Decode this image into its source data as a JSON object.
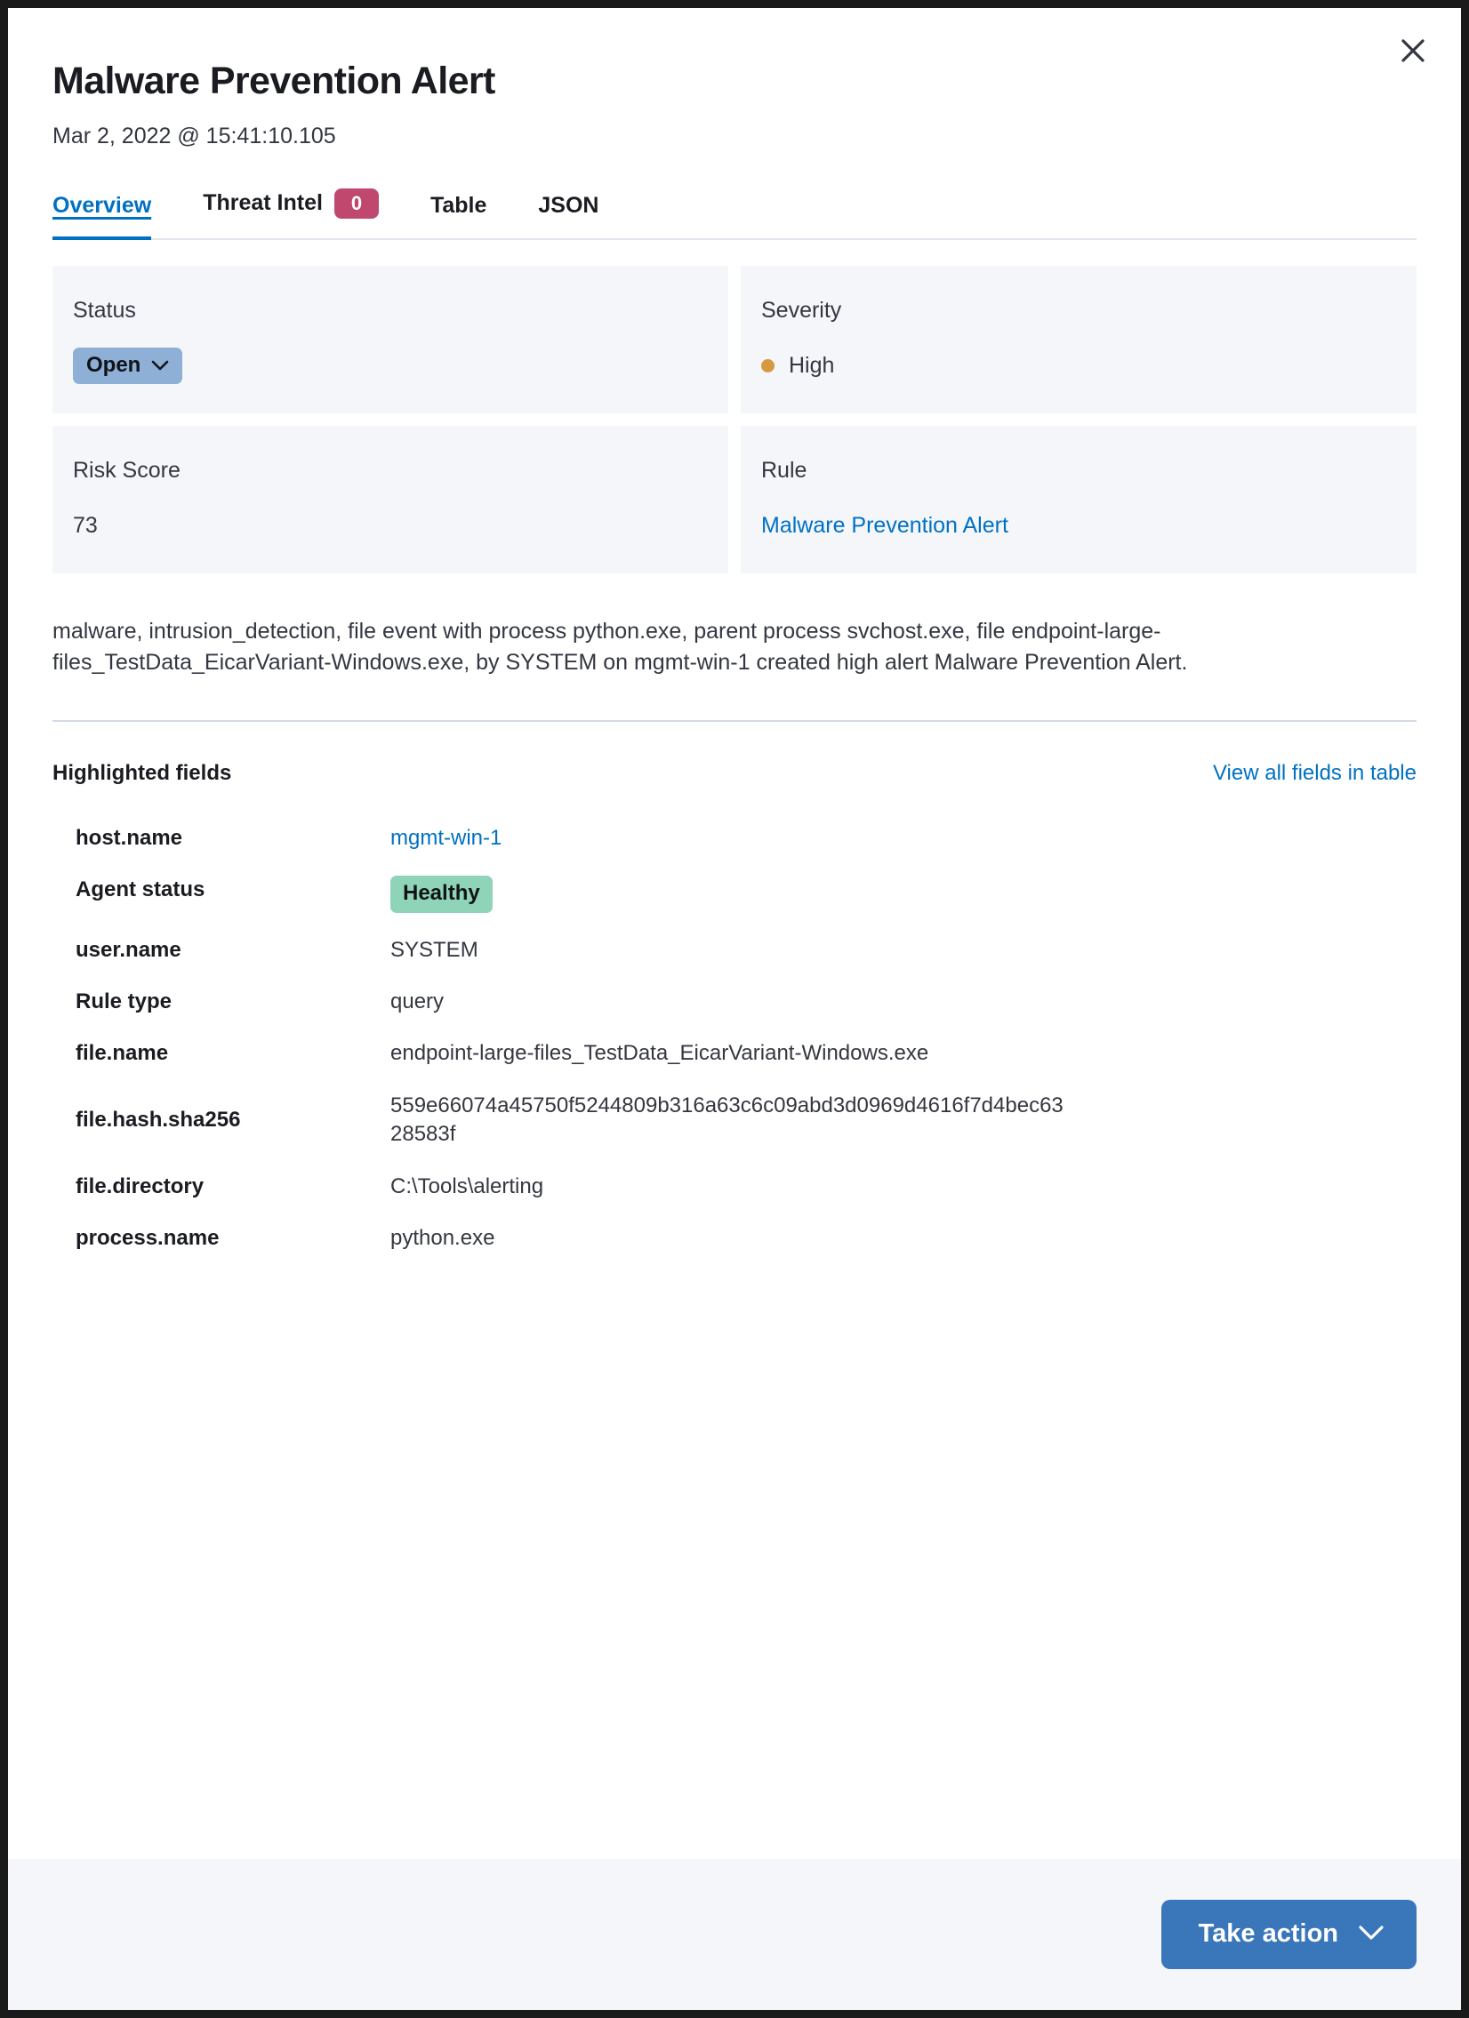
{
  "window": {
    "close_label": "Close",
    "close_icon": "close-icon"
  },
  "header": {
    "title": "Malware Prevention Alert",
    "timestamp": "Mar 2, 2022 @ 15:41:10.105"
  },
  "tabs": [
    {
      "label": "Overview",
      "badge": null,
      "active": true
    },
    {
      "label": "Threat Intel",
      "badge": "0",
      "active": false
    },
    {
      "label": "Table",
      "badge": null,
      "active": false
    },
    {
      "label": "JSON",
      "badge": null,
      "active": false
    }
  ],
  "summary": {
    "status": {
      "label": "Status",
      "value": "Open",
      "chevron_icon": "chevron-down-icon"
    },
    "severity": {
      "label": "Severity",
      "value": "High",
      "dot_color": "#d6993f"
    },
    "risk_score": {
      "label": "Risk Score",
      "value": "73"
    },
    "rule": {
      "label": "Rule",
      "value": "Malware Prevention Alert"
    }
  },
  "reason": "malware, intrusion_detection, file event with process python.exe, parent process svchost.exe, file endpoint-large-files_TestData_EicarVariant-Windows.exe, by SYSTEM on mgmt-win-1 created high alert Malware Prevention Alert.",
  "highlighted_fields": {
    "title": "Highlighted fields",
    "view_all_link": "View all fields in table",
    "rows": [
      {
        "key": "host.name",
        "value": "mgmt-win-1",
        "kind": "link"
      },
      {
        "key": "Agent status",
        "value": "Healthy",
        "kind": "badge"
      },
      {
        "key": "user.name",
        "value": "SYSTEM",
        "kind": "text"
      },
      {
        "key": "Rule type",
        "value": "query",
        "kind": "text"
      },
      {
        "key": "file.name",
        "value": "endpoint-large-files_TestData_EicarVariant-Windows.exe",
        "kind": "text"
      },
      {
        "key": "file.hash.sha256",
        "value": "559e66074a45750f5244809b316a63c6c09abd3d0969d4616f7d4bec6328583f",
        "kind": "text"
      },
      {
        "key": "file.directory",
        "value": "C:\\Tools\\alerting",
        "kind": "text"
      },
      {
        "key": "process.name",
        "value": "python.exe",
        "kind": "text"
      }
    ]
  },
  "footer": {
    "take_action_label": "Take action",
    "chevron_icon": "chevron-down-icon"
  },
  "colors": {
    "accent_blue": "#0071c2",
    "button_blue": "#3a76ba",
    "badge_pink": "#c0486f",
    "status_open": "#8eb0d6",
    "severity_high": "#d6993f",
    "agent_healthy": "#8fd4b8",
    "card_bg": "#f4f6fa"
  }
}
